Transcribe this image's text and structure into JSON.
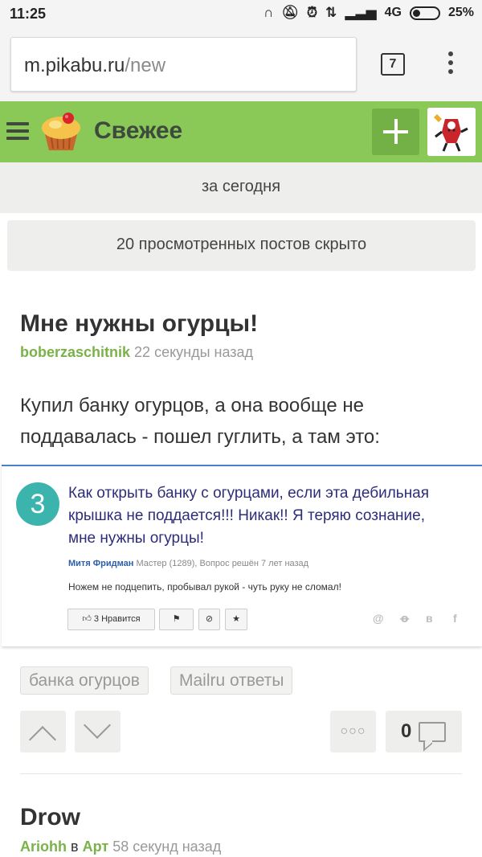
{
  "status_bar": {
    "time": "11:25",
    "network": "4G",
    "battery": "25%"
  },
  "browser": {
    "url_host": "m.pikabu.ru",
    "url_path": "/new",
    "tab_count": "7"
  },
  "header": {
    "title": "Свежее"
  },
  "filter": {
    "period": "за сегодня",
    "hidden_notice": "20 просмотренных постов скрыто"
  },
  "post": {
    "title": "Мне нужны огурцы!",
    "author": "boberzaschitnik",
    "time_ago": "22 секунды назад",
    "text": "Купил банку огурцов, а она вообще не поддавалась - пошел гуглить, а там это:",
    "embed": {
      "answer_count": "3",
      "question": "Как открыть банку с огурцами, если эта дебильная крышка не поддается!!! Никак!! Я теряю сознание, мне нужны огурцы!",
      "asker": "Митя Фридман",
      "asker_info": "Мастер (1289), Вопрос решён 7 лет назад",
      "description": "Ножем не подцепить, пробывал рукой - чуть руку не сломал!",
      "like_label": "3 Нравится",
      "share_icons": [
        "@",
        "ok",
        "в",
        "f"
      ]
    },
    "tags": [
      "банка огурцов",
      "Mailru ответы"
    ],
    "comments_count": "0"
  },
  "post2": {
    "title": "Drow",
    "author": "Ariohh",
    "in_word": "в",
    "community": "Арт",
    "time_ago": "58 секунд назад"
  },
  "colors": {
    "header_green": "#8ac858",
    "author_green": "#7ab24a",
    "answer_badge": "#3cb4ae"
  }
}
